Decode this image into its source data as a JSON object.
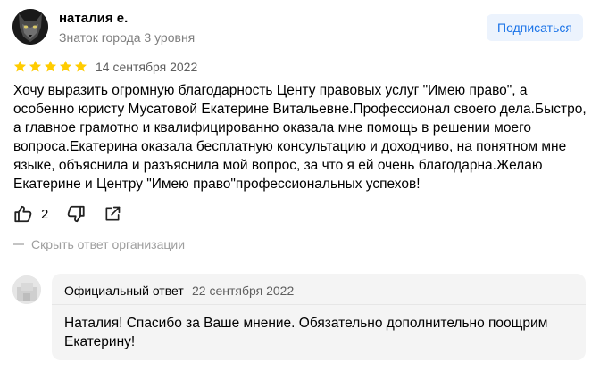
{
  "author": {
    "name": "наталия е.",
    "level": "Знаток города 3 уровня",
    "avatar_icon": "wolf-avatar-icon"
  },
  "subscribe_label": "Подписаться",
  "review": {
    "rating": 5,
    "rating_max": 5,
    "date": "14 сентября 2022",
    "text": "Хочу выразить огромную благодарность Центу правовых услуг \"Имею право\", а особенно юристу Мусатовой Екатерине Витальевне.Профессионал своего дела.Быстро, а главное грамотно и квалифицированно оказала мне помощь в решении моего вопроса.Екатерина оказала бесплатную консультацию и доходчиво, на понятном мне языке, объяснила и разъяснила мой вопрос, за что я ей очень благодарна.Желаю Екатерине и Центру \"Имею право\"профессиональных успехов!"
  },
  "actions": {
    "like_count": "2",
    "icons": [
      "thumbs-up-icon",
      "thumbs-down-icon",
      "share-icon"
    ]
  },
  "hide_answer_label": "Скрыть ответ организации",
  "official_answer": {
    "title": "Официальный ответ",
    "date": "22 сентября 2022",
    "text": "Наталия! Спасибо за Ваше мнение. Обязательно дополнительно поощрим Екатерину!"
  },
  "colors": {
    "star": "#ffcc00",
    "subscribe_bg": "#ecf3fd",
    "subscribe_text": "#1a73e8",
    "muted_text": "#7e7e7e",
    "answer_bg": "#f4f4f4"
  }
}
